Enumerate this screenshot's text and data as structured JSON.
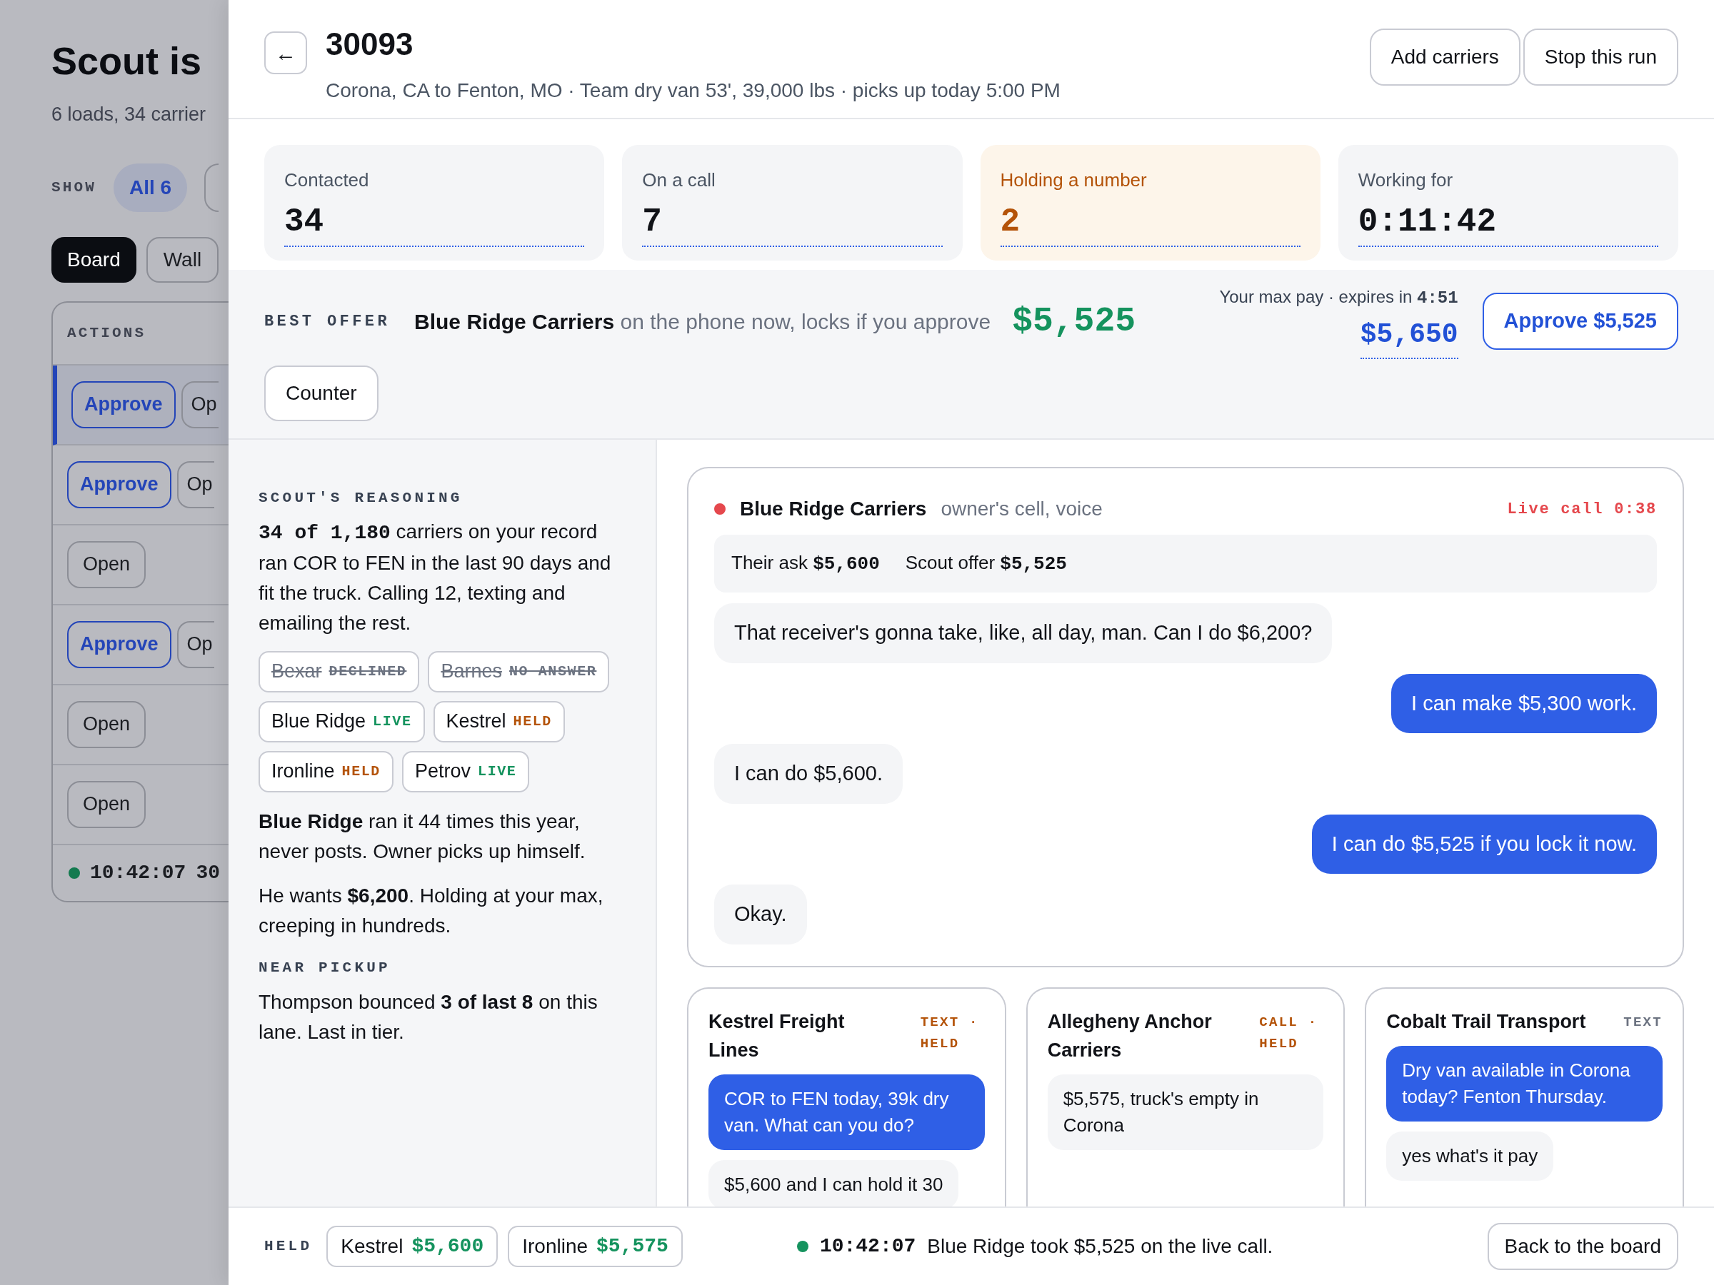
{
  "background": {
    "title": "Scout is",
    "subtitle": "6 loads, 34 carrier",
    "show_label": "SHOW",
    "filters": [
      {
        "label": "All 6",
        "selected": true
      }
    ],
    "views": [
      {
        "label": "Board",
        "selected": true
      },
      {
        "label": "Wall",
        "selected": false
      }
    ],
    "actions_heading": "ACTIONS",
    "rows": [
      {
        "selected": true,
        "buttons": [
          {
            "kind": "approve",
            "label": "Approve"
          },
          {
            "kind": "open",
            "label": "Op"
          }
        ]
      },
      {
        "selected": false,
        "buttons": [
          {
            "kind": "approve",
            "label": "Approve"
          },
          {
            "kind": "open",
            "label": "Op"
          }
        ]
      },
      {
        "selected": false,
        "buttons": [
          {
            "kind": "open",
            "label": "Open"
          }
        ]
      },
      {
        "selected": false,
        "buttons": [
          {
            "kind": "approve",
            "label": "Approve"
          },
          {
            "kind": "open",
            "label": "Op"
          }
        ]
      },
      {
        "selected": false,
        "buttons": [
          {
            "kind": "open",
            "label": "Open"
          }
        ]
      },
      {
        "selected": false,
        "buttons": [
          {
            "kind": "open",
            "label": "Open"
          }
        ]
      }
    ],
    "log": {
      "time": "10:42:07",
      "text": "30"
    }
  },
  "load": {
    "back": "←",
    "id": "30093",
    "route": "Corona, CA to Fenton, MO · Team dry van 53', 39,000 lbs · picks up today 5:00 PM",
    "buttons": [
      "Add carriers",
      "Stop this run"
    ]
  },
  "stats": [
    {
      "label": "Contacted",
      "value": "34",
      "highlight": false
    },
    {
      "label": "On a call",
      "value": "7",
      "highlight": false
    },
    {
      "label": "Holding a number",
      "value": "2",
      "highlight": true
    },
    {
      "label": "Working for",
      "value": "0:11:42",
      "highlight": false
    }
  ],
  "best_offer": {
    "label": "BEST OFFER",
    "carrier": "Blue Ridge Carriers",
    "note": "on the phone now, locks if you approve",
    "amount": "$5,525",
    "max_label": "Your max pay · expires in",
    "expires": "4:51",
    "max_pay": "$5,650",
    "approve": "Approve $5,525",
    "counter": "Counter"
  },
  "reasoning": {
    "heading": "SCOUT'S REASONING",
    "lead": "34 of 1,180",
    "text": " carriers on your record ran COR to FEN in the last 90 days and fit the truck. Calling 12, texting and emailing the rest.",
    "carriers": [
      {
        "name": "Bexar",
        "kind": "declined",
        "label": "DECLINED"
      },
      {
        "name": "Barnes",
        "kind": "declined",
        "label": "NO ANSWER"
      },
      {
        "name": "Blue Ridge",
        "kind": "live",
        "label": "LIVE"
      },
      {
        "name": "Kestrel",
        "kind": "held",
        "label": "HELD"
      },
      {
        "name": "Ironline",
        "kind": "held",
        "label": "HELD"
      },
      {
        "name": "Petrov",
        "kind": "live",
        "label": "LIVE"
      }
    ],
    "notes": [
      "**Blue Ridge** ran it 44 times this year, never posts. Owner picks up himself.",
      "He wants **$6,200**. Holding at your max, creeping in hundreds."
    ],
    "near_heading": "NEAR PICKUP",
    "near_text": "Thompson bounced **3 of last 8** on this lane. Last in tier."
  },
  "live_call": {
    "carrier": "Blue Ridge Carriers",
    "channel": "owner's cell, voice",
    "status": "Live call 0:38",
    "ask_label": "Their ask",
    "ask": "$5,600",
    "offer_label": "Scout offer",
    "offer": "$5,525",
    "messages": [
      {
        "kind": "received",
        "text": "That receiver's gonna take, like, all day, man. Can I do $6,200?"
      },
      {
        "kind": "sent",
        "text": "I can make $5,300 work."
      },
      {
        "kind": "received",
        "text": "I can do $5,600."
      },
      {
        "kind": "sent",
        "text": "I can do $5,525 if you lock it now."
      },
      {
        "kind": "received",
        "text": "Okay."
      }
    ]
  },
  "threads": [
    {
      "carrier": "Kestrel Freight Lines",
      "tag": "TEXT · HELD",
      "held": true,
      "messages": [
        {
          "kind": "sent",
          "text": "COR to FEN today, 39k dry van. What can you do?"
        },
        {
          "kind": "received",
          "text": "$5,600 and I can hold it 30"
        }
      ]
    },
    {
      "carrier": "Allegheny Anchor Carriers",
      "tag": "CALL · HELD",
      "held": true,
      "messages": [
        {
          "kind": "received",
          "text": "$5,575, truck's empty in Corona"
        }
      ]
    },
    {
      "carrier": "Cobalt Trail Transport",
      "tag": "TEXT",
      "held": false,
      "messages": [
        {
          "kind": "sent",
          "text": "Dry van available in Corona today? Fenton Thursday."
        },
        {
          "kind": "received",
          "text": "yes what's it pay"
        }
      ]
    }
  ],
  "footer": {
    "held_label": "HELD",
    "held": [
      {
        "name": "Kestrel",
        "amount": "$5,600"
      },
      {
        "name": "Ironline",
        "amount": "$5,575"
      }
    ],
    "time": "10:42:07",
    "event": "Blue Ridge took $5,525 on the live call.",
    "back": "Back to the board"
  }
}
